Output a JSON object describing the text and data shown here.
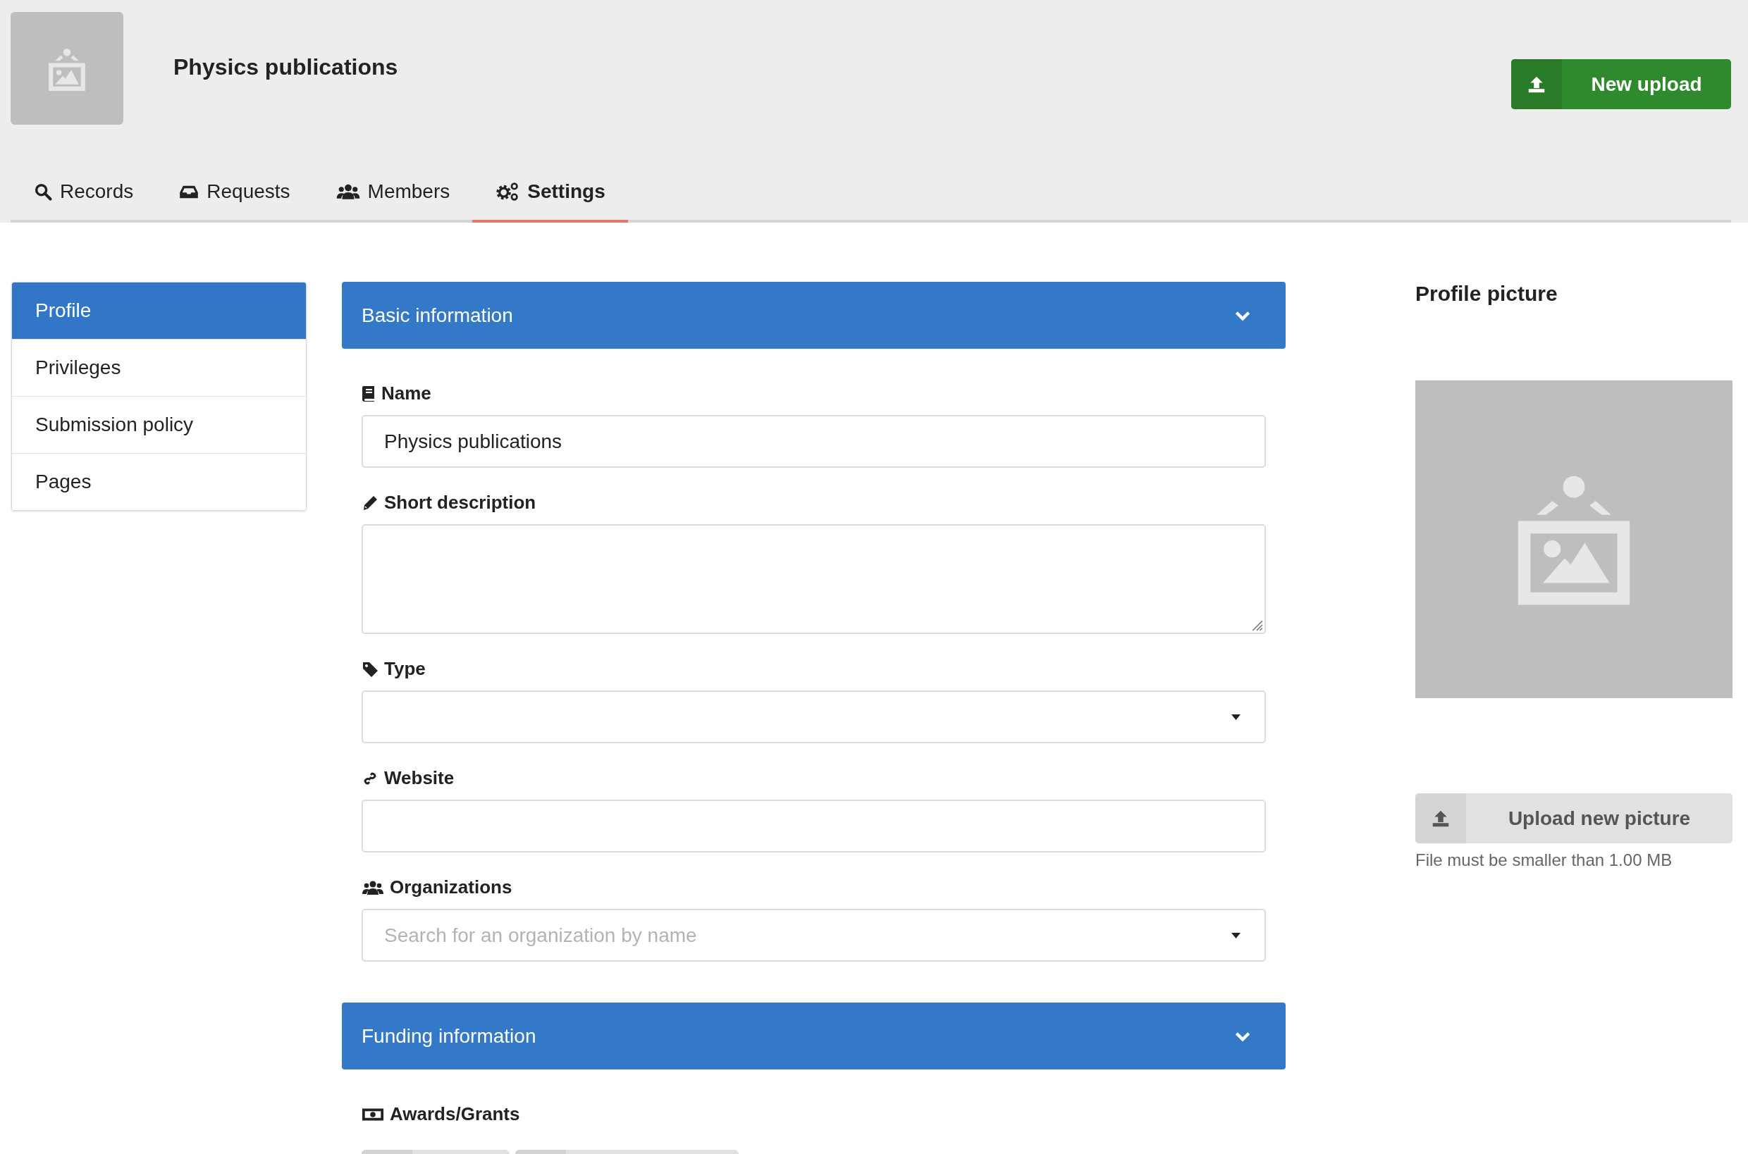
{
  "header": {
    "title": "Physics publications",
    "new_upload": "New upload"
  },
  "tabs": [
    {
      "label": "Records",
      "selected": false
    },
    {
      "label": "Requests",
      "selected": false
    },
    {
      "label": "Members",
      "selected": false
    },
    {
      "label": "Settings",
      "selected": true
    }
  ],
  "sidebar": {
    "items": [
      {
        "label": "Profile",
        "selected": true
      },
      {
        "label": "Privileges",
        "selected": false
      },
      {
        "label": "Submission policy",
        "selected": false
      },
      {
        "label": "Pages",
        "selected": false
      }
    ]
  },
  "sections": [
    {
      "title": "Basic information",
      "fields": [
        {
          "kind": "text",
          "label": "Name",
          "value": "Physics publications"
        },
        {
          "kind": "textarea",
          "label": "Short description"
        },
        {
          "kind": "select",
          "label": "Type"
        },
        {
          "kind": "text",
          "label": "Website"
        },
        {
          "kind": "select",
          "label": "Organizations",
          "placeholder": "Search for an organization by name"
        }
      ]
    },
    {
      "title": "Funding information",
      "fields": [
        {
          "kind": "buttons",
          "label": "Awards/Grants"
        }
      ]
    }
  ],
  "profile_picture": {
    "title": "Profile picture",
    "upload": "Upload new picture",
    "help": "File must be smaller than 1.00 MB"
  }
}
